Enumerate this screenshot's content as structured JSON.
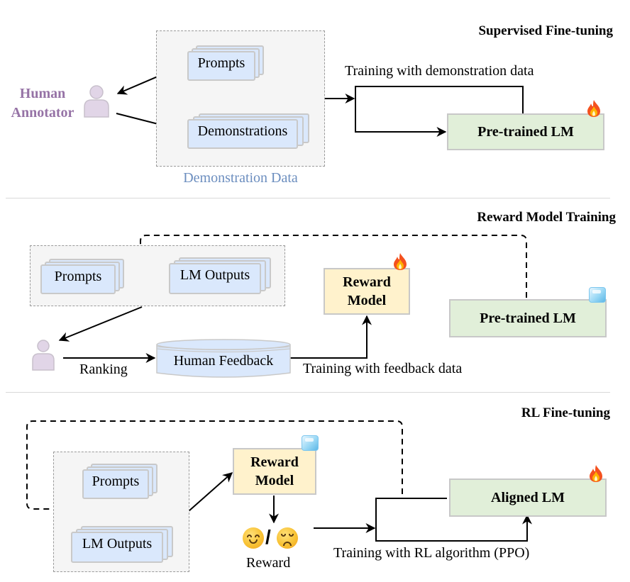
{
  "sections": {
    "sft": {
      "title": "Supervised Fine-tuning",
      "actor_label": "Human Annotator",
      "docs": {
        "prompts": "Prompts",
        "demonstrations": "Demonstrations"
      },
      "group_caption": "Demonstration Data",
      "edge_label": "Training with demonstration data",
      "model": {
        "label": "Pre-trained LM",
        "state": "fire-icon"
      }
    },
    "rm": {
      "title": "Reward Model Training",
      "docs": {
        "prompts": "Prompts",
        "outputs": "LM Outputs"
      },
      "feedback_store": "Human Feedback",
      "ranking_label": "Ranking",
      "edge_label": "Training with feedback data",
      "reward_model": {
        "label_line1": "Reward",
        "label_line2": "Model",
        "state": "fire-icon"
      },
      "pretrained": {
        "label": "Pre-trained LM",
        "state": "ice-icon"
      }
    },
    "rl": {
      "title": "RL Fine-tuning",
      "docs": {
        "prompts": "Prompts",
        "outputs": "LM Outputs"
      },
      "reward_model": {
        "label_line1": "Reward",
        "label_line2": "Model",
        "state": "ice-icon"
      },
      "reward_caption": "Reward",
      "reward_separator": "/",
      "edge_label": "Training with RL algorithm (PPO)",
      "aligned": {
        "label": "Aligned LM",
        "state": "fire-icon"
      }
    }
  },
  "colors": {
    "doc_fill": "#dae8fc",
    "model_green": "#e1efd9",
    "model_yellow": "#fff2cc",
    "actor_purple": "#9673a6",
    "caption_blue": "#6c8ebf"
  }
}
